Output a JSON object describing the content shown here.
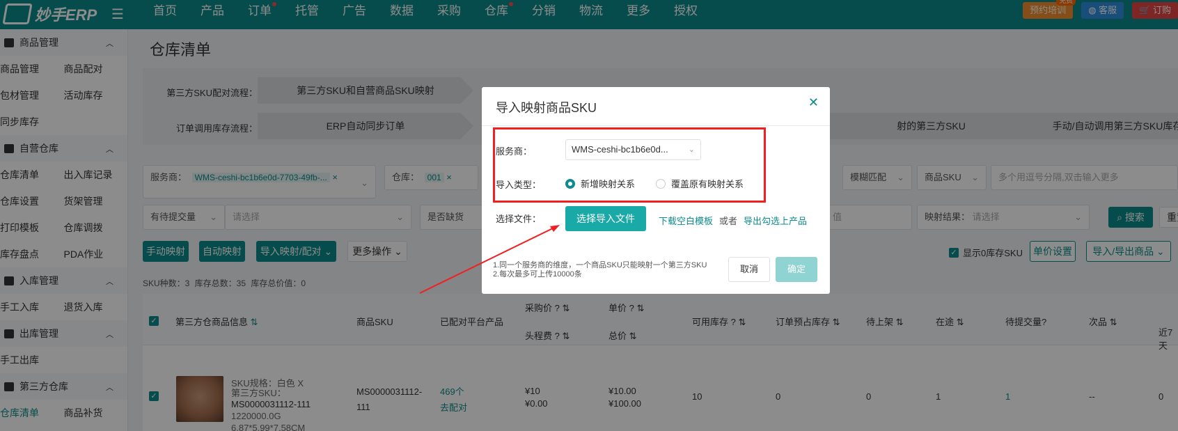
{
  "header": {
    "logo_text": "妙手ERP",
    "nav": [
      {
        "label": "首页",
        "dot": false
      },
      {
        "label": "产品",
        "dot": false
      },
      {
        "label": "订单",
        "dot": true
      },
      {
        "label": "托管",
        "dot": false
      },
      {
        "label": "广告",
        "dot": false
      },
      {
        "label": "数据",
        "dot": false
      },
      {
        "label": "采购",
        "dot": false
      },
      {
        "label": "仓库",
        "dot": true
      },
      {
        "label": "分销",
        "dot": false
      },
      {
        "label": "物流",
        "dot": false
      },
      {
        "label": "更多",
        "dot": false
      },
      {
        "label": "授权",
        "dot": false
      }
    ],
    "training_label": "预约培训",
    "free_badge": "免费",
    "service_label": "客服",
    "order_label": "订购"
  },
  "sidebar": {
    "groups": [
      {
        "title": "商品管理",
        "rows": [
          [
            "商品管理",
            "商品配对"
          ],
          [
            "包材管理",
            "活动库存"
          ],
          [
            "同步库存"
          ]
        ]
      },
      {
        "title": "自营仓库",
        "rows": [
          [
            "仓库清单",
            "出入库记录"
          ],
          [
            "仓库设置",
            "货架管理"
          ],
          [
            "打印模板",
            "仓库调拨"
          ],
          [
            "库存盘点",
            "PDA作业"
          ]
        ]
      },
      {
        "title": "入库管理",
        "rows": [
          [
            "手工入库",
            "退货入库"
          ]
        ]
      },
      {
        "title": "出库管理",
        "rows": [
          [
            "手工出库"
          ]
        ]
      },
      {
        "title": "第三方仓库",
        "rows": [
          [
            "仓库清单",
            "商品补货"
          ]
        ]
      }
    ]
  },
  "page": {
    "title": "仓库清单",
    "flow1_label": "第三方SKU配对流程：",
    "flow1_step1": "第三方SKU和自营商品SKU映射",
    "flow2_label": "订单调用库存流程：",
    "flow2_step1": "ERP自动同步订单",
    "flow2_step3": "射的第三方SKU",
    "flow2_step4": "手动/自动调用第三方SKU库存"
  },
  "filters": {
    "provider_label": "服务商：",
    "provider_tag": "WMS-ceshi-bc1b6e0d-7703-49fb-...",
    "warehouse_label": "仓库：",
    "warehouse_tag": "001",
    "fuzzy_label": "模糊匹配",
    "sku_type_label": "商品SKU",
    "sku_placeholder": "多个用逗号分隔,双击输入更多",
    "pending_label": "有待提交量",
    "pending_placeholder": "请选择",
    "missing_label": "是否缺货",
    "value_placeholder": "值",
    "mapping_result_label": "映射结果：",
    "mapping_result_placeholder": "请选择",
    "search_label": "搜索",
    "reset_label": "重置"
  },
  "actions": {
    "manual_map": "手动映射",
    "auto_map": "自动映射",
    "import_map": "导入映射/配对",
    "more_ops": "更多操作",
    "show_zero_stock": "显示0库存SKU",
    "unit_price_settings": "单价设置",
    "import_export": "导入/导出商品"
  },
  "stats": {
    "text": "SKU种数：3    库存总数：35    库存总价值：0"
  },
  "table": {
    "headers": {
      "third_party_info": "第三方仓商品信息",
      "product_sku": "商品SKU",
      "paired_products": "已配对平台产品",
      "purchase_price": "采购价",
      "head_fee": "头程费",
      "unit_price": "单价",
      "total_price": "总价",
      "available_stock": "可用库存",
      "order_reserved": "订单预占库存",
      "pending_shelf": "待上架",
      "in_transit": "在途",
      "pending_submit": "待提交量",
      "defective": "次品",
      "last7": "近7天"
    },
    "row": {
      "spec": "SKU规格：白色 X",
      "third_sku_label": "第三方SKU：",
      "third_sku_value": "MS0000031112-111",
      "weight": "1220000.0G",
      "dims": "6.87*5.99*7.58CM",
      "product_sku": "MS0000031112-111",
      "paired_count": "469个",
      "go_pair": "去配对",
      "purchase_price": "¥10",
      "head_fee": "¥0.00",
      "unit_price": "¥10.00",
      "total_price": "¥100.00",
      "available_stock": "10",
      "order_reserved": "0",
      "pending_shelf": "0",
      "in_transit": "1",
      "pending_submit": "1",
      "defective": "--",
      "last7": "0"
    }
  },
  "modal": {
    "title": "导入映射商品SKU",
    "provider_label": "服务商：",
    "provider_value": "WMS-ceshi-bc1b6e0d...",
    "import_type_label": "导入类型：",
    "option_new": "新增映射关系",
    "option_overwrite": "覆盖原有映射关系",
    "file_label": "选择文件：",
    "choose_file": "选择导入文件",
    "download_template": "下载空白模板",
    "or_text": "或者",
    "export_selected": "导出勾选上产品",
    "note1": "1.同一个服务商的维度，一个商品SKU只能映射一个第三方SKU",
    "note2": "2.每次最多可上传10000条",
    "cancel": "取消",
    "confirm": "确定"
  },
  "colors": {
    "brand": "#0d8b8b",
    "highlight_box": "#f02020"
  }
}
